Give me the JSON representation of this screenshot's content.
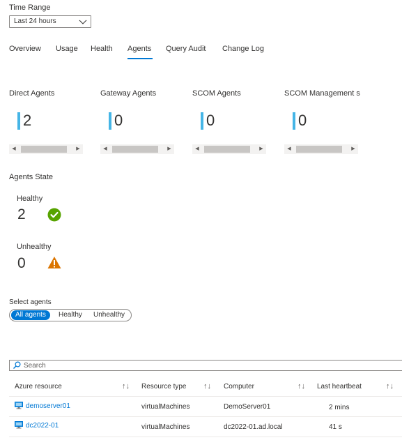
{
  "time_range": {
    "label": "Time Range",
    "selected": "Last 24 hours"
  },
  "tabs": [
    {
      "label": "Overview"
    },
    {
      "label": "Usage"
    },
    {
      "label": "Health"
    },
    {
      "label": "Agents",
      "active": true
    },
    {
      "label": "Query Audit"
    },
    {
      "label": "Change Log"
    }
  ],
  "tiles": [
    {
      "title": "Direct Agents",
      "value": "2"
    },
    {
      "title": "Gateway Agents",
      "value": "0"
    },
    {
      "title": "SCOM Agents",
      "value": "0"
    },
    {
      "title": "SCOM Management s",
      "value": "0"
    }
  ],
  "agents_state": {
    "title": "Agents State",
    "healthy": {
      "label": "Healthy",
      "value": "2"
    },
    "unhealthy": {
      "label": "Unhealthy",
      "value": "0"
    }
  },
  "select_agents": {
    "label": "Select agents",
    "options": [
      "All agents",
      "Healthy",
      "Unhealthy"
    ],
    "selected": "All agents"
  },
  "search": {
    "placeholder": "Search"
  },
  "table": {
    "columns": [
      "Azure resource",
      "Resource type",
      "Computer",
      "Last heartbeat"
    ],
    "rows": [
      {
        "resource": "demoserver01",
        "type": "virtualMachines",
        "computer": "DemoServer01",
        "heartbeat": "2 mins"
      },
      {
        "resource": "dc2022-01",
        "type": "virtualMachines",
        "computer": "dc2022-01.ad.local",
        "heartbeat": "41 s"
      }
    ]
  },
  "colors": {
    "accent": "#0078d4",
    "tile_bar": "#45b5e6",
    "healthy": "#57a300",
    "warning": "#db7500"
  },
  "icons": {
    "healthy": "check-circle-icon",
    "unhealthy": "warning-triangle-icon",
    "search": "search-icon",
    "dropdown": "chevron-down-icon",
    "sort": "sort-icon",
    "resource": "virtual-machine-icon"
  }
}
